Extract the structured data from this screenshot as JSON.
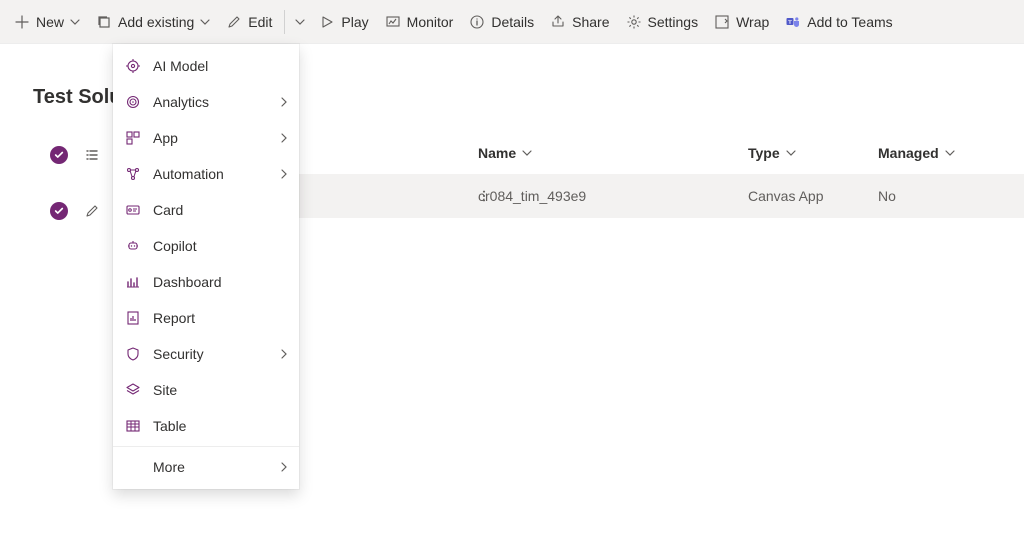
{
  "toolbar": {
    "new": "New",
    "add_existing": "Add existing",
    "edit": "Edit",
    "play": "Play",
    "monitor": "Monitor",
    "details": "Details",
    "share": "Share",
    "settings": "Settings",
    "wrap": "Wrap",
    "add_to_teams": "Add to Teams"
  },
  "page_title": "Test Solu",
  "menu": {
    "items": [
      {
        "label": "AI Model",
        "icon": "ai-model",
        "submenu": false
      },
      {
        "label": "Analytics",
        "icon": "analytics",
        "submenu": true
      },
      {
        "label": "App",
        "icon": "app",
        "submenu": true
      },
      {
        "label": "Automation",
        "icon": "automation",
        "submenu": true
      },
      {
        "label": "Card",
        "icon": "card",
        "submenu": false
      },
      {
        "label": "Copilot",
        "icon": "copilot",
        "submenu": false
      },
      {
        "label": "Dashboard",
        "icon": "dashboard",
        "submenu": false
      },
      {
        "label": "Report",
        "icon": "report",
        "submenu": false
      },
      {
        "label": "Security",
        "icon": "security",
        "submenu": true
      },
      {
        "label": "Site",
        "icon": "site",
        "submenu": false
      },
      {
        "label": "Table",
        "icon": "table",
        "submenu": false
      }
    ],
    "more": "More"
  },
  "table": {
    "columns": {
      "name": "Name",
      "type": "Type",
      "managed": "Managed"
    },
    "rows": [
      {
        "name": "cr084_tim_493e9",
        "type": "Canvas App",
        "managed": "No"
      }
    ]
  }
}
